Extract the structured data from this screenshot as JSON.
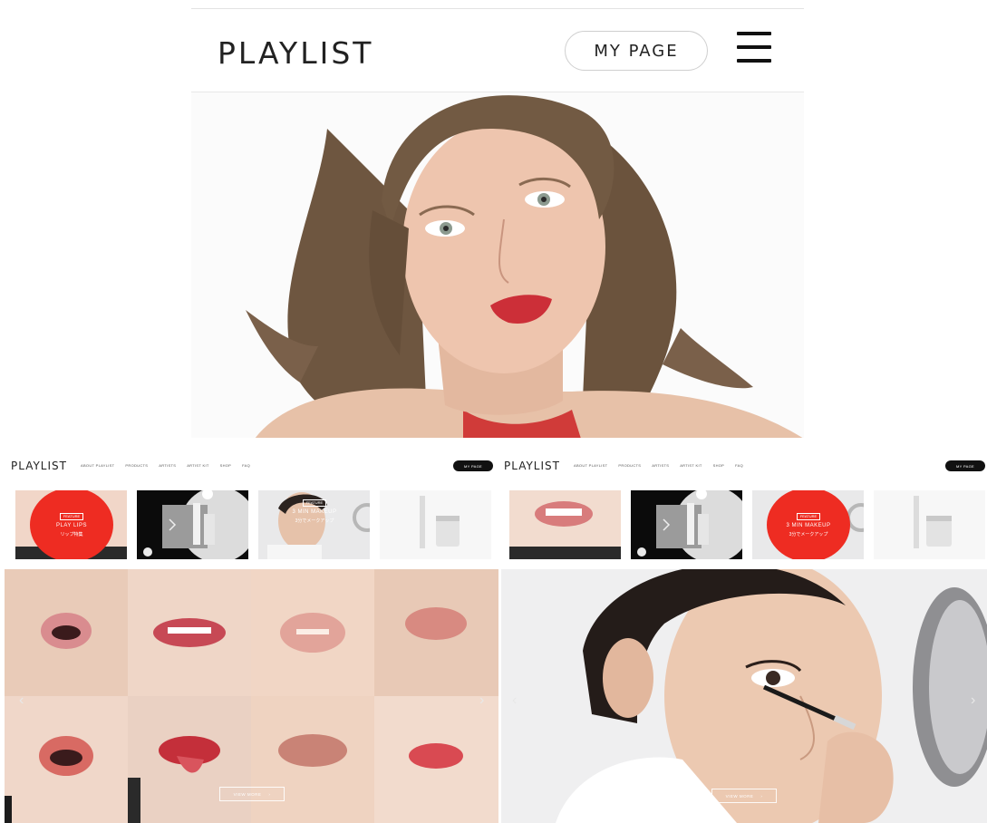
{
  "mobile": {
    "logo": "PLAYLIST",
    "my_page_label": "MY PAGE"
  },
  "desktop_left": {
    "logo": "PLAYLIST",
    "nav": [
      "ABOUT PLAYLIST",
      "PRODUCTS",
      "ARTISTS",
      "ARTIST KIT",
      "SHOP",
      "FAQ"
    ],
    "my_page_label": "MY PAGE",
    "feature": {
      "tag": "FEATURE",
      "title": "PLAY LIPS",
      "subtitle": "リップ特集"
    },
    "overlay": {
      "tag": "FEATURE",
      "title": "3 MIN MAKEUP",
      "subtitle": "3分でメークアップ"
    },
    "prev_arrow": "‹",
    "next_arrow": "›",
    "view_more": "VIEW MORE",
    "view_more_arrow": "›"
  },
  "desktop_right": {
    "logo": "PLAYLIST",
    "nav": [
      "ABOUT PLAYLIST",
      "PRODUCTS",
      "ARTISTS",
      "ARTIST KIT",
      "SHOP",
      "FAQ"
    ],
    "my_page_label": "MY PAGE",
    "feature": {
      "tag": "FEATURE",
      "title": "3 MIN MAKEUP",
      "subtitle": "3分でメークアップ"
    },
    "prev_arrow": "‹",
    "next_arrow": "›",
    "view_more": "VIEW MORE",
    "view_more_arrow": "›"
  },
  "colors": {
    "accent_red": "#ee2c22",
    "my_page_bg": "#111111",
    "lips": "#c9474e"
  },
  "icons": [
    "hamburger-menu-icon",
    "chevron-right-icon",
    "chevron-left-icon"
  ]
}
